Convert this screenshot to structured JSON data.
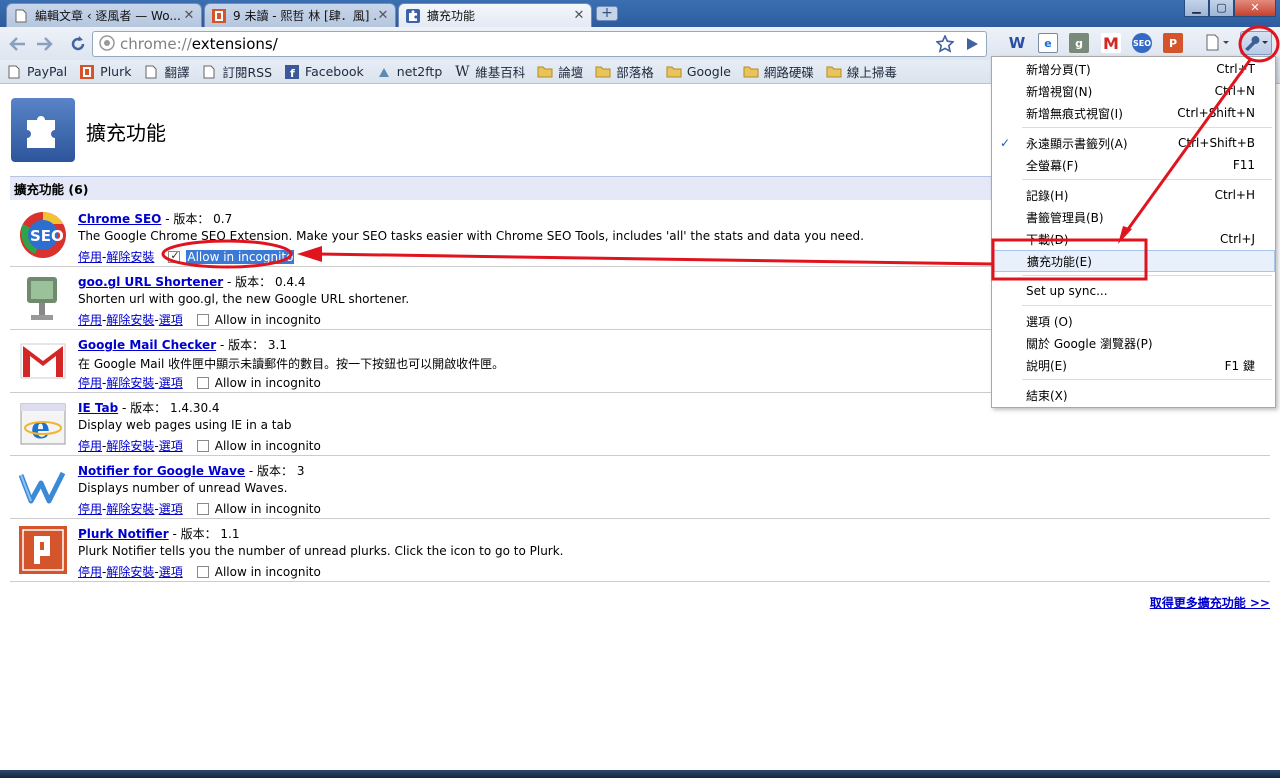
{
  "tabs": [
    {
      "title": "編輯文章 ‹ 逐風者 — Wo...",
      "icon": "page-icon",
      "active": false
    },
    {
      "title": "9 未讀 - 熙哲 林 [肆．風] ...",
      "icon": "plurk-icon",
      "active": false
    },
    {
      "title": "擴充功能",
      "icon": "puzzle-icon",
      "active": true
    }
  ],
  "window_controls": {
    "minimize": "▁",
    "maximize": "▢",
    "close": "✕"
  },
  "toolbar": {
    "url_scheme": "chrome://",
    "url_host": "extensions/",
    "extension_icons": [
      "w-icon",
      "ie-tab-icon",
      "goo-gl-icon",
      "gmail-icon",
      "seo-icon",
      "plurk-icon"
    ]
  },
  "bookmarks": [
    {
      "label": "PayPal",
      "icon": "page-icon"
    },
    {
      "label": "Plurk",
      "icon": "plurk-icon"
    },
    {
      "label": "翻譯",
      "icon": "page-icon"
    },
    {
      "label": "訂閱RSS",
      "icon": "page-icon"
    },
    {
      "label": "Facebook",
      "icon": "facebook-icon"
    },
    {
      "label": "net2ftp",
      "icon": "net2ftp-icon"
    },
    {
      "label": "維基百科",
      "icon": "wikipedia-icon"
    },
    {
      "label": "論壇",
      "icon": "folder-icon"
    },
    {
      "label": "部落格",
      "icon": "folder-icon"
    },
    {
      "label": "Google",
      "icon": "folder-icon"
    },
    {
      "label": "網路硬碟",
      "icon": "folder-icon"
    },
    {
      "label": "線上掃毒",
      "icon": "folder-icon"
    }
  ],
  "page": {
    "title": "擴充功能",
    "section_title": "擴充功能 (6)",
    "more_link": "取得更多擴充功能 >>",
    "version_label": " - 版本： ",
    "disable_label": "停用",
    "uninstall_label": "解除安裝",
    "options_label": "選項",
    "incognito_label": "Allow in incognito",
    "sep": " - "
  },
  "extensions": [
    {
      "name": "Chrome SEO",
      "version": "0.7",
      "description": "The Google Chrome SEO Extension. Make your SEO tasks easier with Chrome SEO Tools, includes 'all' the stats and data you need.",
      "has_options": false,
      "incognito": true,
      "icon": "seo-icon"
    },
    {
      "name": "goo.gl URL Shortener",
      "version": "0.4.4",
      "description": "Shorten url with goo.gl, the new Google URL shortener.",
      "has_options": true,
      "incognito": false,
      "icon": "goo-gl-icon"
    },
    {
      "name": "Google Mail Checker",
      "version": "3.1",
      "description": "在 Google Mail 收件匣中顯示未讀郵件的數目。按一下按鈕也可以開啟收件匣。",
      "has_options": true,
      "incognito": false,
      "icon": "gmail-icon"
    },
    {
      "name": "IE Tab",
      "version": "1.4.30.4",
      "description": "Display web pages using IE in a tab",
      "has_options": true,
      "incognito": false,
      "icon": "ie-tab-icon"
    },
    {
      "name": "Notifier for Google Wave",
      "version": "3",
      "description": "Displays number of unread Waves.",
      "has_options": true,
      "incognito": false,
      "icon": "wave-icon"
    },
    {
      "name": "Plurk Notifier",
      "version": "1.1",
      "description": "Plurk Notifier tells you the number of unread plurks. Click the icon to go to Plurk.",
      "has_options": true,
      "incognito": false,
      "icon": "plurk-icon"
    }
  ],
  "menu": {
    "items": [
      {
        "label": "新增分頁(T)",
        "shortcut": "Ctrl+T"
      },
      {
        "label": "新增視窗(N)",
        "shortcut": "Ctrl+N"
      },
      {
        "label": "新增無痕式視窗(I)",
        "shortcut": "Ctrl+Shift+N"
      },
      {
        "label": "永遠顯示書籤列(A)",
        "shortcut": "Ctrl+Shift+B",
        "checked": true
      },
      {
        "label": "全螢幕(F)",
        "shortcut": "F11"
      },
      {
        "label": "記錄(H)",
        "shortcut": "Ctrl+H"
      },
      {
        "label": "書籤管理員(B)",
        "shortcut": ""
      },
      {
        "label": "下載(D)",
        "shortcut": "Ctrl+J"
      },
      {
        "label": "擴充功能(E)",
        "shortcut": "",
        "highlighted": true
      },
      {
        "label": "Set up sync...",
        "shortcut": ""
      },
      {
        "label": "選項 (O)",
        "shortcut": ""
      },
      {
        "label": "關於 Google 瀏覽器(P)",
        "shortcut": ""
      },
      {
        "label": "說明(E)",
        "shortcut": "F1 鍵"
      },
      {
        "label": "結束(X)",
        "shortcut": ""
      }
    ],
    "checkmark": "✓"
  },
  "colors": {
    "annotation": "#e0141e",
    "link": "#0000cc",
    "selection": "#3a79d6"
  }
}
